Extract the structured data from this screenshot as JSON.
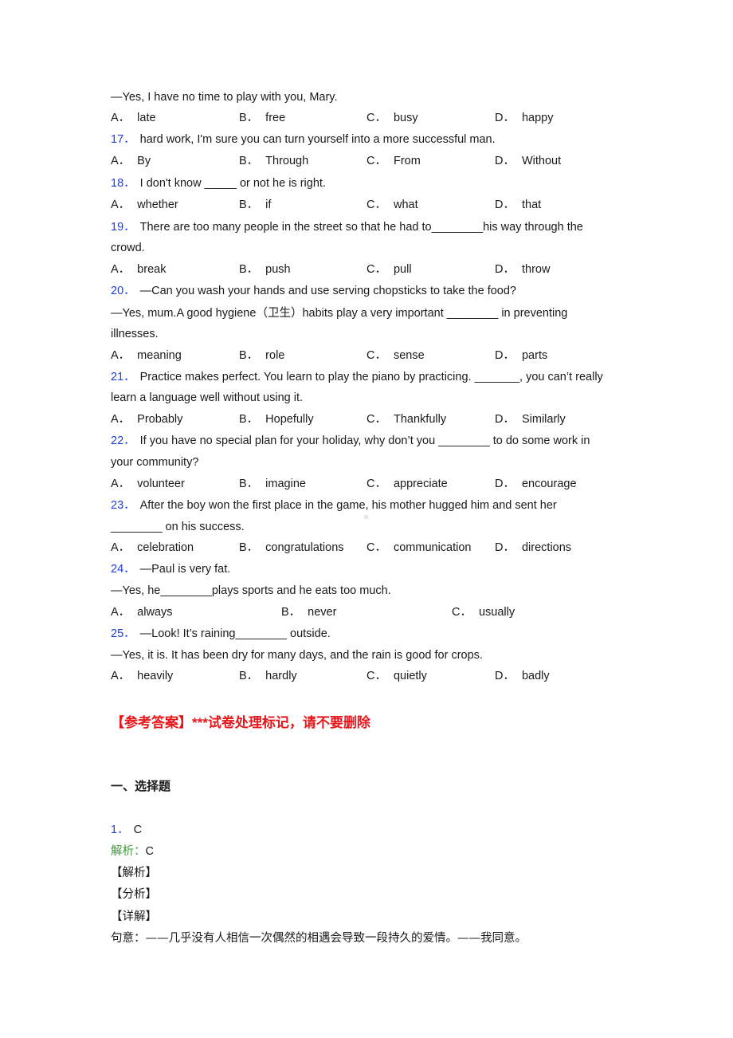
{
  "questions": {
    "q16": {
      "tail": "—Yes, I have no time to play with you, Mary.",
      "options": [
        {
          "label": "A．",
          "text": "late"
        },
        {
          "label": "B．",
          "text": "free"
        },
        {
          "label": "C．",
          "text": "busy"
        },
        {
          "label": "D．",
          "text": "happy"
        }
      ]
    },
    "q17": {
      "num": "17．",
      "text": "hard work, I'm sure you can turn yourself into a more successful man.",
      "options": [
        {
          "label": "A．",
          "text": "By"
        },
        {
          "label": "B．",
          "text": "Through"
        },
        {
          "label": "C．",
          "text": "From"
        },
        {
          "label": "D．",
          "text": "Without"
        }
      ]
    },
    "q18": {
      "num": "18．",
      "text": "I don't know _____ or not he is right.",
      "options": [
        {
          "label": "A．",
          "text": "whether"
        },
        {
          "label": "B．",
          "text": "if"
        },
        {
          "label": "C．",
          "text": "what"
        },
        {
          "label": "D．",
          "text": "that"
        }
      ]
    },
    "q19": {
      "num": "19．",
      "text": "There are too many people in the street so that he had to________his way through the",
      "text2": "crowd.",
      "options": [
        {
          "label": "A．",
          "text": "break"
        },
        {
          "label": "B．",
          "text": "push"
        },
        {
          "label": "C．",
          "text": "pull"
        },
        {
          "label": "D．",
          "text": "throw"
        }
      ]
    },
    "q20": {
      "num": "20．",
      "text": "—Can you wash your hands and use serving chopsticks to take the food?",
      "text2": "—Yes, mum.A good hygiene（卫生）habits play a very important ________ in preventing",
      "text3": "illnesses.",
      "options": [
        {
          "label": "A．",
          "text": "meaning"
        },
        {
          "label": "B．",
          "text": "role"
        },
        {
          "label": "C．",
          "text": "sense"
        },
        {
          "label": "D．",
          "text": "parts"
        }
      ]
    },
    "q21": {
      "num": "21．",
      "text": "Practice makes perfect. You learn to play the piano by practicing. _______, you can’t really",
      "text2": "learn a language well without using it.",
      "options": [
        {
          "label": "A．",
          "text": "Probably"
        },
        {
          "label": "B．",
          "text": "Hopefully"
        },
        {
          "label": "C．",
          "text": "Thankfully"
        },
        {
          "label": "D．",
          "text": "Similarly"
        }
      ]
    },
    "q22": {
      "num": "22．",
      "text": "If you have no special plan for your holiday, why don’t you ________ to do some work in",
      "text2": "your community?",
      "options": [
        {
          "label": "A．",
          "text": "volunteer"
        },
        {
          "label": "B．",
          "text": "imagine"
        },
        {
          "label": "C．",
          "text": "appreciate"
        },
        {
          "label": "D．",
          "text": "encourage"
        }
      ]
    },
    "q23": {
      "num": "23．",
      "text": "After the boy won the first place in the game, his mother hugged him and sent her",
      "text2": "________ on his success.",
      "options": [
        {
          "label": "A．",
          "text": "celebration"
        },
        {
          "label": "B．",
          "text": "congratulations"
        },
        {
          "label": "C．",
          "text": "communication"
        },
        {
          "label": "D．",
          "text": "directions"
        }
      ]
    },
    "q24": {
      "num": "24．",
      "text": "—Paul is very fat.",
      "text2": "—Yes, he________plays sports and he eats too much.",
      "options": [
        {
          "label": "A．",
          "text": "always"
        },
        {
          "label": "B．",
          "text": "never"
        },
        {
          "label": "C．",
          "text": "usually"
        }
      ]
    },
    "q25": {
      "num": "25．",
      "text": "—Look! It’s raining________ outside.",
      "text2": "—Yes, it is. It has been dry for many days, and the rain is good for crops.",
      "options": [
        {
          "label": "A．",
          "text": "heavily"
        },
        {
          "label": "B．",
          "text": "hardly"
        },
        {
          "label": "C．",
          "text": "quietly"
        },
        {
          "label": "D．",
          "text": "badly"
        }
      ]
    }
  },
  "answers": {
    "title": "【参考答案】***试卷处理标记，请不要删除",
    "section": "一、选择题",
    "first": {
      "num": "1．",
      "answer": "C",
      "analysis_label": "解析：",
      "analysis_value": "C",
      "tag_analysis": "【解析】",
      "tag_fenxi": "【分析】",
      "tag_detail": "【详解】",
      "meaning": "句意：——几乎没有人相信一次偶然的相遇会导致一段持久的爱情。——我同意。"
    }
  },
  "colors": {
    "question_number": "#1f3ee0",
    "answer_title": "#e8171c",
    "analysis_label": "#3f9a3a",
    "text": "#1a1a1a"
  }
}
